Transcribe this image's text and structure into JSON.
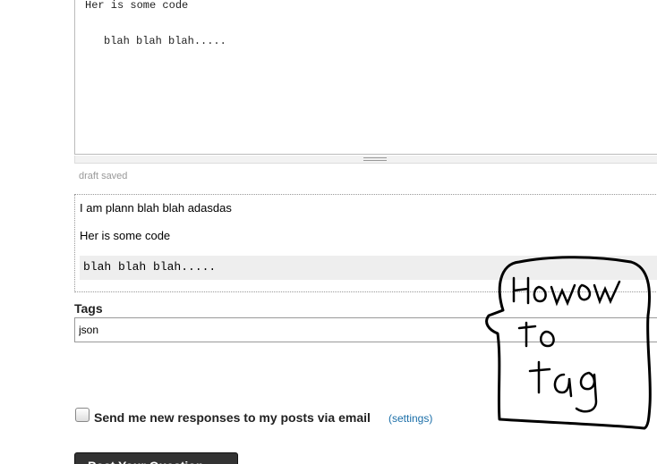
{
  "editor": {
    "line1": "Her is some code",
    "line2": "blah blah blah....."
  },
  "draft_status": "draft saved",
  "preview": {
    "paragraph1": "I am plann blah blah adasdas",
    "paragraph2": "Her is some code",
    "code": "blah blah blah....."
  },
  "tags": {
    "label": "Tags",
    "value": "json"
  },
  "notify": {
    "label": "Send me new responses to my posts via email",
    "settings_link": "(settings)"
  },
  "post_button": "Post Your Question",
  "sketch": {
    "text": "How to tag",
    "color": "#000000"
  }
}
